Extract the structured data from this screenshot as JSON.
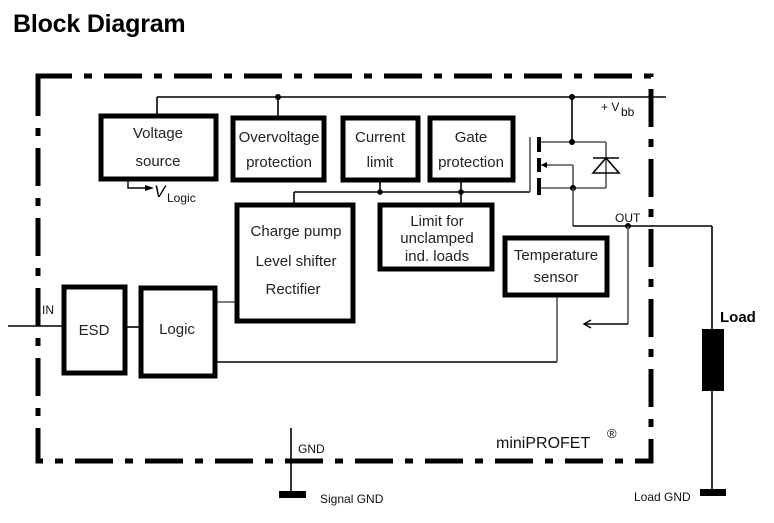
{
  "title": "Block Diagram",
  "blocks": {
    "voltage_source": [
      "Voltage",
      "source"
    ],
    "overvoltage": [
      "Overvoltage",
      "protection"
    ],
    "current_limit": [
      "Current",
      "limit"
    ],
    "gate_protection": [
      "Gate",
      "protection"
    ],
    "charge_pump": [
      "Charge pump",
      "Level shifter",
      "Rectifier"
    ],
    "limit_unclamped": [
      "Limit for",
      "unclamped",
      "ind. loads"
    ],
    "temperature_sensor": [
      "Temperature",
      "sensor"
    ],
    "esd": "ESD",
    "logic": "Logic"
  },
  "labels": {
    "v_logic_main": "V",
    "v_logic_sub": "Logic",
    "vbb_prefix": "+ V",
    "vbb_sub": "bb",
    "in": "IN",
    "out": "OUT",
    "gnd": "GND",
    "signal_gnd": "Signal GND",
    "load": "Load",
    "load_gnd": "Load GND",
    "product": "miniPROFET",
    "registered": "®"
  }
}
